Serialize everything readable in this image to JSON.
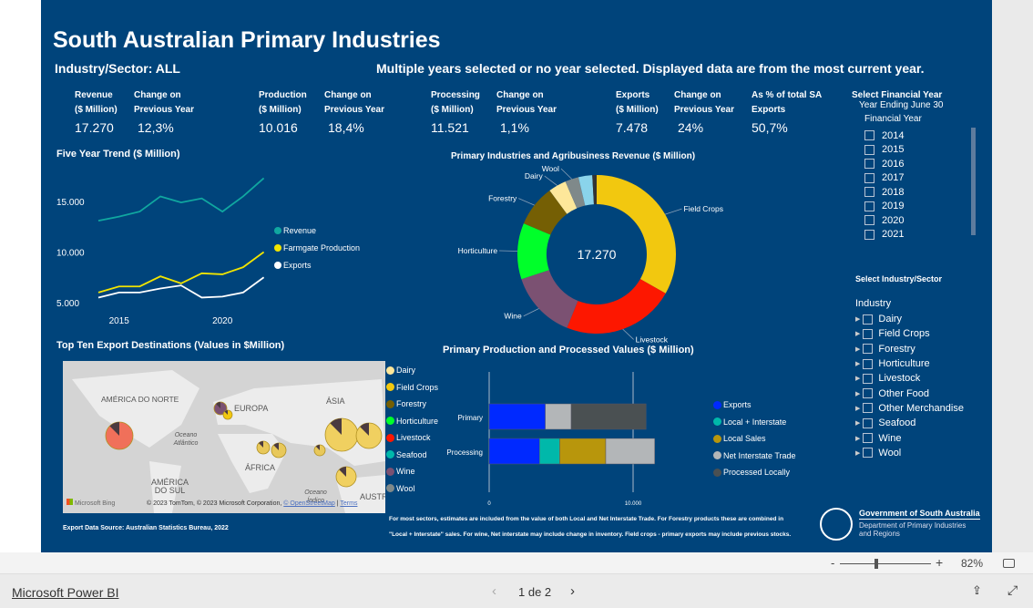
{
  "header": {
    "title": "South Australian Primary Industries",
    "sector": "Industry/Sector: ALL",
    "note": "Multiple years selected or no year selected. Displayed data are from the most current year."
  },
  "kpis": [
    {
      "l1": "Revenue",
      "l2": "($ Million)",
      "value": "17.270"
    },
    {
      "l1": "Change on",
      "l2": "Previous Year",
      "value": "12,3%"
    },
    {
      "l1": "Production",
      "l2": "($ Million)",
      "value": "10.016"
    },
    {
      "l1": "Change on",
      "l2": "Previous Year",
      "value": "18,4%"
    },
    {
      "l1": "Processing",
      "l2": "($ Million)",
      "value": "11.521"
    },
    {
      "l1": "Change on",
      "l2": "Previous Year",
      "value": "1,1%"
    },
    {
      "l1": "Exports",
      "l2": "($ Million)",
      "value": "7.478"
    },
    {
      "l1": "Change on",
      "l2": "Previous Year",
      "value": "24%"
    },
    {
      "l1": "As % of total SA",
      "l2": "Exports",
      "value": "50,7%"
    }
  ],
  "year_slicer": {
    "title1": "Select  Financial Year",
    "title2": "Year Ending June 30",
    "header": "Financial Year",
    "years": [
      "2014",
      "2015",
      "2016",
      "2017",
      "2018",
      "2019",
      "2020",
      "2021"
    ]
  },
  "industry_slicer": {
    "title": "Select Industry/Sector",
    "header": "Industry",
    "items": [
      "Dairy",
      "Field Crops",
      "Forestry",
      "Horticulture",
      "Livestock",
      "Other Food",
      "Other Merchandise",
      "Seafood",
      "Wine",
      "Wool"
    ]
  },
  "chart_data": [
    {
      "type": "line",
      "title": "Five Year Trend ($ Million)",
      "x": [
        2014,
        2015,
        2016,
        2017,
        2018,
        2019,
        2020,
        2021,
        2022
      ],
      "xticks": [
        "2015",
        "2020"
      ],
      "yticks": [
        "5.000",
        "10.000",
        "15.000"
      ],
      "ylim": [
        4500,
        18500
      ],
      "legend": "right",
      "series": [
        {
          "name": "Revenue",
          "color": "#10a7a0",
          "values": [
            13100,
            13500,
            14000,
            15500,
            14900,
            15300,
            14000,
            15500,
            17300
          ]
        },
        {
          "name": "Farmgate Production",
          "color": "#f2e500",
          "values": [
            6000,
            6600,
            6600,
            7600,
            6900,
            7900,
            7800,
            8500,
            10000
          ]
        },
        {
          "name": "Exports",
          "color": "#ffffff",
          "values": [
            5500,
            6000,
            6000,
            6400,
            6700,
            5500,
            5600,
            6000,
            7500
          ]
        }
      ]
    },
    {
      "type": "pie",
      "title": "Primary Industries and Agribusiness Revenue ($ Million)",
      "center_label": "17.270",
      "slices": [
        {
          "label": "Field Crops",
          "value": 5650,
          "color": "#f2c80f"
        },
        {
          "label": "Livestock",
          "value": 3900,
          "color": "#fd1700"
        },
        {
          "label": "Wine",
          "value": 2350,
          "color": "#7b5172"
        },
        {
          "label": "Horticulture",
          "value": 1950,
          "color": "#00ff2a"
        },
        {
          "label": "Forestry",
          "value": 1450,
          "color": "#755f04"
        },
        {
          "label": "Dairy",
          "value": 620,
          "color": "#fde79a"
        },
        {
          "label": "Wool",
          "value": 470,
          "color": "#7f898a"
        },
        {
          "label": "",
          "value": 480,
          "color": "#8ad4eb"
        },
        {
          "label": "",
          "value": 150,
          "color": "#333333"
        }
      ]
    },
    {
      "type": "bar",
      "orientation": "horizontal",
      "stacked": true,
      "title": "Primary Production and Processed Values ($ Million)",
      "categories": [
        "Primary",
        "Processing"
      ],
      "xticks": [
        "0",
        "10.000"
      ],
      "xlim": [
        0,
        13000
      ],
      "legend": "right",
      "series": [
        {
          "name": "Exports",
          "color": "#0029ff",
          "values": [
            3900,
            3500
          ]
        },
        {
          "name": "Local + Interstate",
          "color": "#00b8aa",
          "values": [
            0,
            1400
          ]
        },
        {
          "name": "Local Sales",
          "color": "#b8960c",
          "values": [
            0,
            3200
          ]
        },
        {
          "name": "Net Interstate Trade",
          "color": "#b3b6b8",
          "values": [
            1800,
            3400
          ]
        },
        {
          "name": "Processed Locally",
          "color": "#4a5052",
          "values": [
            5200,
            0
          ]
        }
      ]
    }
  ],
  "map": {
    "title": "Top Ten Export Destinations (Values in $Million)",
    "labels": [
      "AMÉRICA DO NORTE",
      "EUROPA",
      "ÁSIA",
      "Oceano Atlântico",
      "ÁFRICA",
      "AMÉRICA DO SUL",
      "Oceano Índico",
      "AUSTRÁL"
    ],
    "bing": "Microsoft Bing",
    "copyright": "© 2023 TomTom, © 2023 Microsoft Corporation, ",
    "osm": "© OpenStreetMap",
    "terms": "Terms",
    "source": "Export Data Source: Australian Statistics Bureau, 2022",
    "legend": [
      {
        "name": "Dairy",
        "color": "#fde79a"
      },
      {
        "name": "Field Crops",
        "color": "#f2c80f"
      },
      {
        "name": "Forestry",
        "color": "#755f04"
      },
      {
        "name": "Horticulture",
        "color": "#00ff2a"
      },
      {
        "name": "Livestock",
        "color": "#fd1700"
      },
      {
        "name": "Seafood",
        "color": "#00b8aa"
      },
      {
        "name": "Wine",
        "color": "#7b5172"
      },
      {
        "name": "Wool",
        "color": "#7f898a"
      }
    ]
  },
  "footnote1": "For  most sectors, estimates are included from the value of both Local and Net Interstate Trade. For  Forestry products these are combined in",
  "footnote2": "\"Local + Interstate\" sales. For wine, Net interstate may include change in inventory. Field crops - primary exports may include previous stocks.",
  "logo": {
    "gov": "Government of South Australia",
    "dept1": "Department of Primary Industries",
    "dept2": "and Regions"
  },
  "zoom": {
    "minus": "-",
    "plus": "+",
    "level": "82%"
  },
  "footer": {
    "brand": "Microsoft Power BI",
    "page": "1 de 2"
  }
}
